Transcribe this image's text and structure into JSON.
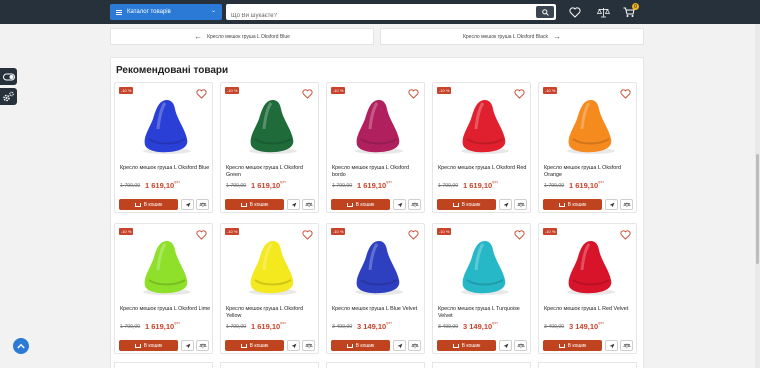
{
  "header": {
    "catalog_label": "Каталог товарів",
    "search_placeholder": "Що Ви шукаєте?",
    "cart_count": "0"
  },
  "nav": {
    "prev_label": "Кресло мешок груша L Oksford Blue",
    "next_label": "Кресло мешок груша L Oksford Black"
  },
  "section": {
    "title": "Рекомендовані товари"
  },
  "buy_label": "В кошик",
  "currency": "грн",
  "products": [
    {
      "name": "Кресло мешок груша L Oksford Blue",
      "badge": "-10 %",
      "old_price": "1 799,00",
      "price": "1 619,10",
      "color": "#2a3fd6"
    },
    {
      "name": "Кресло мешок груша L Oksford Green",
      "badge": "-10 %",
      "old_price": "1 799,00",
      "price": "1 619,10",
      "color": "#1f6b3a"
    },
    {
      "name": "Кресло мешок груша L Oksford bordo",
      "badge": "-10 %",
      "old_price": "1 799,00",
      "price": "1 619,10",
      "color": "#b0205e"
    },
    {
      "name": "Кресло мешок груша L Oksford Red",
      "badge": "-10 %",
      "old_price": "1 799,00",
      "price": "1 619,10",
      "color": "#e0202e"
    },
    {
      "name": "Кресло мешок груша L Oksford Orange",
      "badge": "-10 %",
      "old_price": "1 799,00",
      "price": "1 619,10",
      "color": "#f58a1f"
    },
    {
      "name": "Кресло мешок груша L Oksford Lime",
      "badge": "-10 %",
      "old_price": "1 799,00",
      "price": "1 619,10",
      "color": "#8ee02a"
    },
    {
      "name": "Кресло мешок груша L Oksford Yellow",
      "badge": "-10 %",
      "old_price": "1 799,00",
      "price": "1 619,10",
      "color": "#f4e81e"
    },
    {
      "name": "Кресло мешок груша L Blue Velvet",
      "badge": "-10 %",
      "old_price": "3 499,00",
      "price": "3 149,10",
      "color": "#2e3fc0"
    },
    {
      "name": "Кресло мешок груша L Turquoise Velvet",
      "badge": "-10 %",
      "old_price": "3 499,00",
      "price": "3 149,10",
      "color": "#27b8c8"
    },
    {
      "name": "Кресло мешок груша L Red Velvet",
      "badge": "-10 %",
      "old_price": "3 499,00",
      "price": "3 149,10",
      "color": "#d8142a"
    }
  ],
  "icons": {
    "heart": "heart-icon",
    "compare": "scales-icon",
    "cart": "cart-icon",
    "send": "paper-plane-icon",
    "search": "search-icon"
  }
}
